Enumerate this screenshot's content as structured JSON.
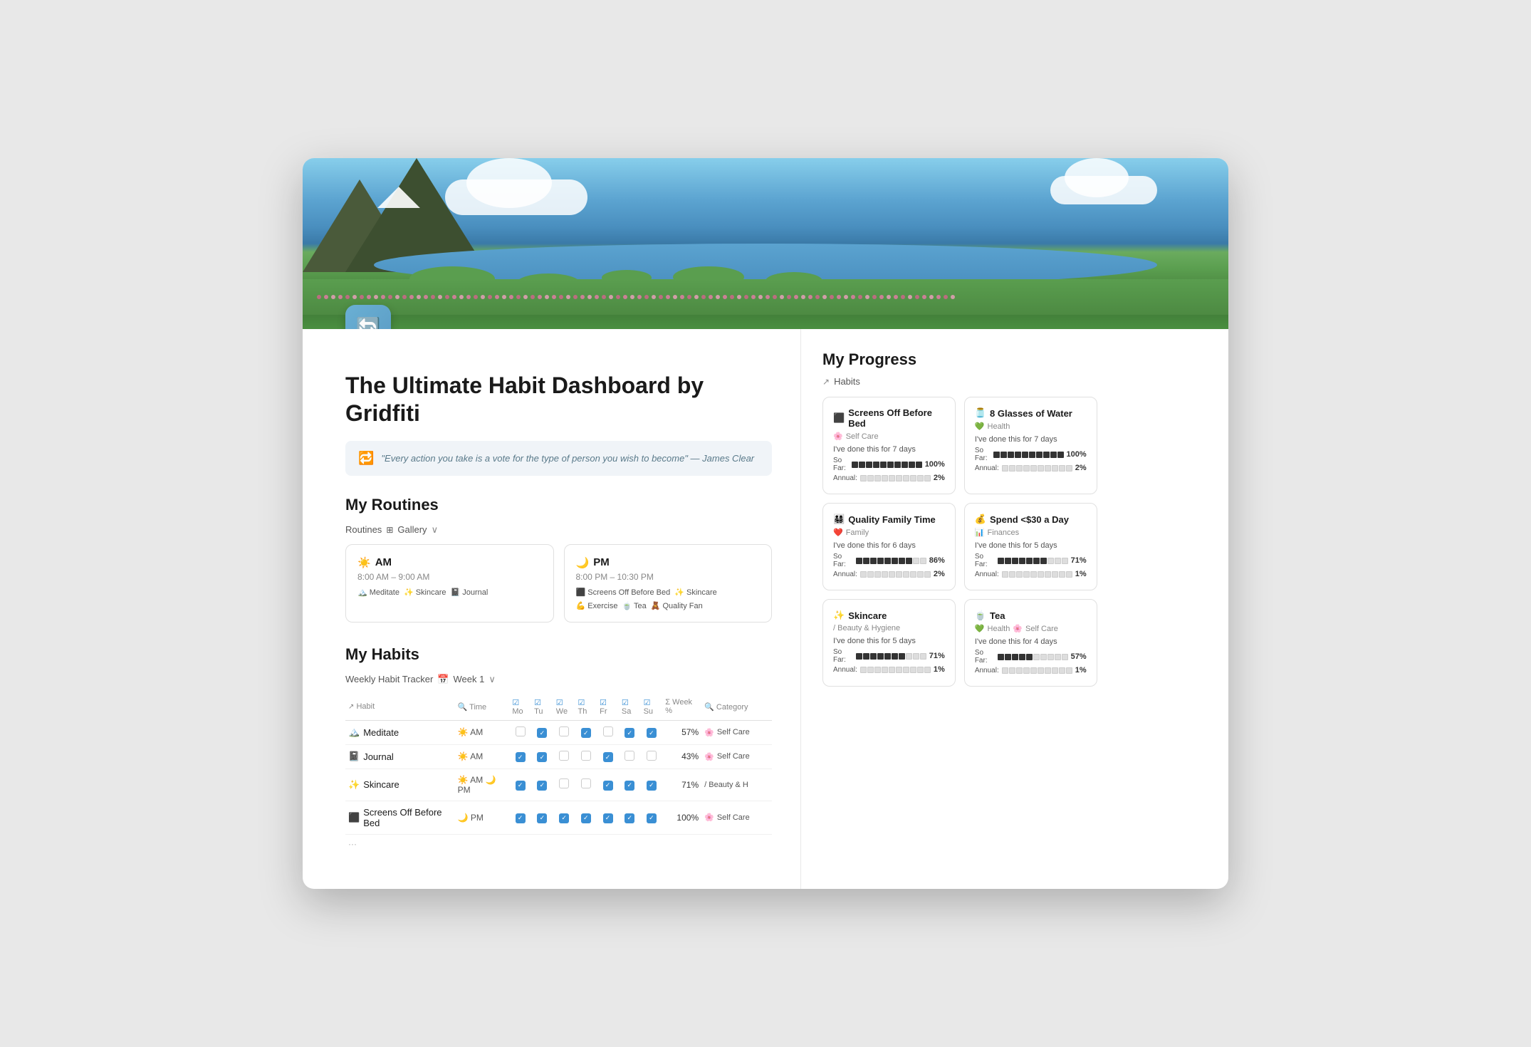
{
  "header": {
    "title": "The Ultimate Habit Dashboard by Gridfiti"
  },
  "quote": {
    "text": "\"Every action you take is a vote for the type of person you wish to become\" — James Clear"
  },
  "routines": {
    "section_title": "My Routines",
    "label": "Routines",
    "view": "Gallery",
    "cards": [
      {
        "emoji": "☀️",
        "title": "AM",
        "time": "8:00 AM – 9:00 AM",
        "tags": [
          "🏔️ Meditate",
          "✨ Skincare",
          "📓 Journal"
        ]
      },
      {
        "emoji": "🌙",
        "title": "PM",
        "time": "8:00 PM – 10:30 PM",
        "tags": [
          "⬛ Screens Off Before Bed",
          "✨ Skincare",
          "💪 Exercise",
          "🍵 Tea",
          "🧸 Quality Fam"
        ]
      }
    ]
  },
  "habits": {
    "section_title": "My Habits",
    "tracker_label": "Weekly Habit Tracker",
    "week_label": "Week 1",
    "columns": [
      "Habit",
      "Time",
      "Mo",
      "Tu",
      "We",
      "Th",
      "Fr",
      "Sa",
      "Su",
      "Week %",
      "Category"
    ],
    "rows": [
      {
        "emoji": "🏔️",
        "name": "Meditate",
        "time_emoji": "☀️",
        "time": "AM",
        "days": [
          false,
          true,
          false,
          true,
          false,
          true,
          true
        ],
        "pct": "57%",
        "cat_emoji": "🌸",
        "cat": "Self Care"
      },
      {
        "emoji": "📓",
        "name": "Journal",
        "time_emoji": "☀️",
        "time": "AM",
        "days": [
          true,
          true,
          false,
          false,
          true,
          false,
          false
        ],
        "pct": "43%",
        "cat_emoji": "🌸",
        "cat": "Self Care"
      },
      {
        "emoji": "✨",
        "name": "Skincare",
        "time_emoji": "☀️🌙",
        "time": "AM 🌙 PM",
        "days": [
          true,
          true,
          false,
          false,
          true,
          true,
          true
        ],
        "pct": "71%",
        "cat_emoji": "/",
        "cat": "Beauty & H"
      },
      {
        "emoji": "⬛",
        "name": "Screens Off Before Bed",
        "time_emoji": "🌙",
        "time": "PM",
        "days": [
          true,
          true,
          true,
          true,
          true,
          true,
          true
        ],
        "pct": "100%",
        "cat_emoji": "🌸",
        "cat": "Self Care"
      }
    ]
  },
  "progress": {
    "title": "My Progress",
    "habits_label": "Habits",
    "cards": [
      {
        "emoji": "⬛",
        "title": "Screens Off Before Bed",
        "cat_emoji": "🌸",
        "cat": "Self Care",
        "done_text": "I've done this for 7 days",
        "so_far_label": "So Far:",
        "so_far_filled": 10,
        "so_far_empty": 0,
        "so_far_pct": "100%",
        "annual_label": "Annual:",
        "annual_filled": 0,
        "annual_empty": 10,
        "annual_pct": "2%"
      },
      {
        "emoji": "🫙",
        "title": "8 Glasses of Water",
        "cat_emoji": "💚",
        "cat": "Health",
        "done_text": "I've done this for 7 days",
        "so_far_label": "So Far:",
        "so_far_filled": 10,
        "so_far_empty": 0,
        "so_far_pct": "100%",
        "annual_label": "Annual:",
        "annual_filled": 0,
        "annual_empty": 10,
        "annual_pct": "2%"
      },
      {
        "emoji": "👨‍👩‍👧‍👦",
        "title": "Quality Family Time",
        "cat_emoji": "❤️",
        "cat": "Family",
        "done_text": "I've done this for 6 days",
        "so_far_label": "So Far:",
        "so_far_filled": 8,
        "so_far_empty": 2,
        "so_far_pct": "86%",
        "annual_label": "Annual:",
        "annual_filled": 0,
        "annual_empty": 10,
        "annual_pct": "2%"
      },
      {
        "emoji": "💰",
        "title": "Spend <$30 a Day",
        "cat_emoji": "📊",
        "cat": "Finances",
        "done_text": "I've done this for 5 days",
        "so_far_label": "So Far:",
        "so_far_filled": 7,
        "so_far_empty": 3,
        "so_far_pct": "71%",
        "annual_label": "Annual:",
        "annual_filled": 0,
        "annual_empty": 10,
        "annual_pct": "1%"
      },
      {
        "emoji": "✨",
        "title": "Skincare",
        "cat_emoji": "/",
        "cat": "Beauty & Hygiene",
        "done_text": "I've done this for 5 days",
        "so_far_label": "So Far:",
        "so_far_filled": 7,
        "so_far_empty": 3,
        "so_far_pct": "71%",
        "annual_label": "Annual:",
        "annual_filled": 0,
        "annual_empty": 10,
        "annual_pct": "1%"
      },
      {
        "emoji": "🍵",
        "title": "Tea",
        "cat_emoji": "💚🌸",
        "cat": "Health · Self Care",
        "done_text": "I've done this for 4 days",
        "so_far_label": "So Far:",
        "so_far_filled": 5,
        "so_far_empty": 5,
        "so_far_pct": "57%",
        "annual_label": "Annual:",
        "annual_filled": 0,
        "annual_empty": 10,
        "annual_pct": "1%"
      }
    ]
  }
}
